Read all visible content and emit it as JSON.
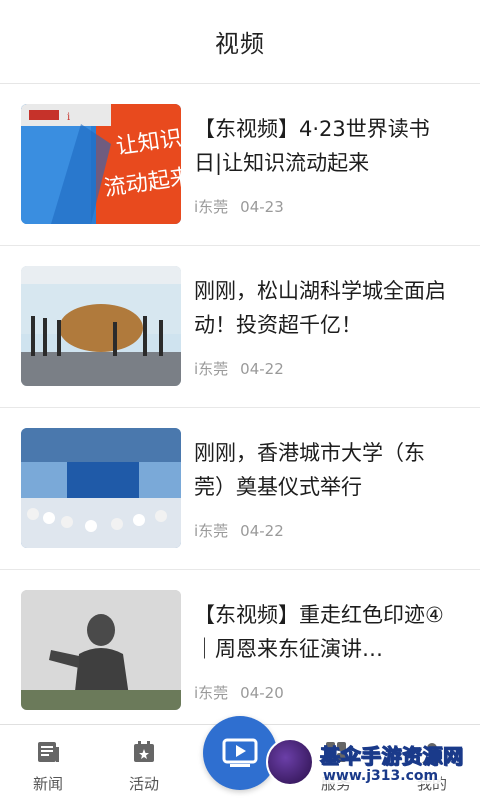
{
  "header": {
    "title": "视频"
  },
  "news": [
    {
      "title": "【东视频】4·23世界读书日|让知识流动起来",
      "source": "i东莞",
      "date": "04-23",
      "thumb": "book-day"
    },
    {
      "title": "刚刚，松山湖科学城全面启动！投资超千亿！",
      "source": "i东莞",
      "date": "04-22",
      "thumb": "ceremony-stone"
    },
    {
      "title": "刚刚，香港城市大学（东莞）奠基仪式举行",
      "source": "i东莞",
      "date": "04-22",
      "thumb": "groundbreaking"
    },
    {
      "title": "【东视频】重走红色印迹④｜周恩来东征演讲…",
      "source": "i东莞",
      "date": "04-20",
      "thumb": "statue"
    }
  ],
  "thumb_texts": {
    "book_cover": "让知识流动起来"
  },
  "tabbar": {
    "tabs": [
      {
        "label": "新闻",
        "icon": "news-icon"
      },
      {
        "label": "活动",
        "icon": "calendar-icon"
      },
      {
        "label": "",
        "icon": "video-play-icon"
      },
      {
        "label": "服务",
        "icon": "service-icon"
      },
      {
        "label": "我的",
        "icon": "profile-icon"
      }
    ]
  },
  "watermark": {
    "title": "基伞手游资源网",
    "url": "www.j313.com"
  },
  "colors": {
    "accent": "#2f6fd0",
    "meta": "#9a9a9a",
    "title": "#1d1d1d"
  }
}
